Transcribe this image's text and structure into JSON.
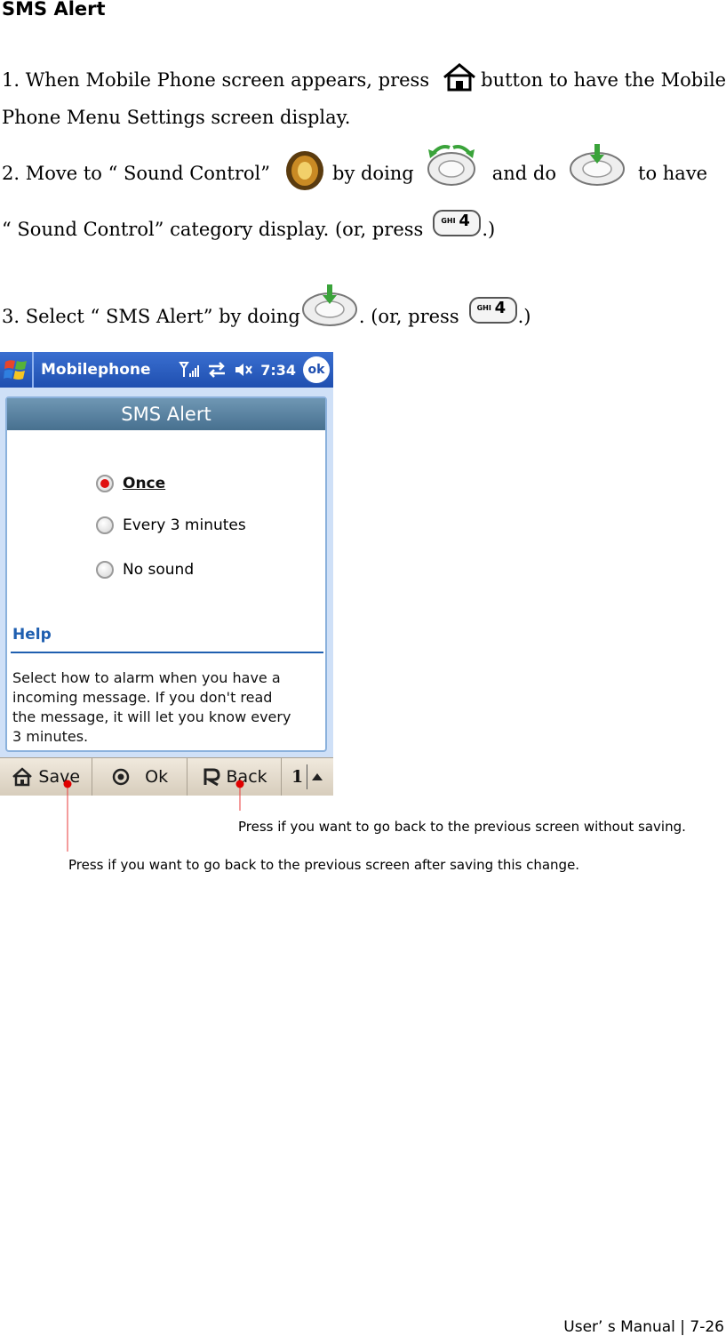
{
  "heading": "SMS Alert",
  "steps": {
    "s1_a": "1. When Mobile Phone screen appears, press",
    "s1_b": "button to have the Mobile",
    "s1_c": "Phone Menu Settings screen display.",
    "s2_a": "2. Move to “ Sound Control”",
    "s2_b": "by doing",
    "s2_c": "and do",
    "s2_d": "to have",
    "s2_e": "“ Sound Control”  category display. (or, press",
    "s2_f": ".)",
    "s3_a": "3. Select “ SMS Alert”  by doing",
    "s3_b": ". (or, press",
    "s3_c": ".)",
    "key_label": "GHI",
    "key_digit": "4"
  },
  "phone": {
    "app_name": "Mobilephone",
    "time": "7:34",
    "ok": "ok",
    "screen_title": "SMS Alert",
    "options": [
      "Once",
      "Every 3 minutes",
      "No sound"
    ],
    "selected_index": 0,
    "help_title": "Help",
    "help_lines": [
      "Select how to alarm when you have a",
      "incoming message. If you don't read",
      "the message, it will let you know every",
      "3 minutes."
    ],
    "softkeys": {
      "save": "Save",
      "ok": "Ok",
      "back": "Back",
      "page": "1"
    }
  },
  "annotations": {
    "back_note": "Press if you want to go back to the previous screen without saving.",
    "save_note": "Press if you want to go back to the previous screen after saving this change."
  },
  "colors": {
    "annotation_line": "#e83a3a",
    "annotation_dot": "#e00000",
    "title_bar": "#1f4fb0"
  },
  "footer": "User’ s Manual  |  7-26"
}
